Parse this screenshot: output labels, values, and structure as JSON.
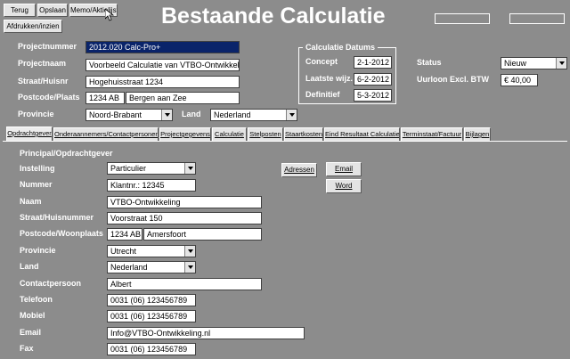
{
  "toolbar": {
    "back_label": "Terug",
    "save_label": "Opslaan",
    "memo_label": "Memo/Aktielijst",
    "print_label": "Afdrukken/inzien"
  },
  "title": "Bestaande Calculatie",
  "project": {
    "number_label": "Projectnummer",
    "number_value": "2012.020 Calc-Pro+",
    "name_label": "Projectnaam",
    "name_value": "Voorbeeld Calculatie van VTBO-Ontwikkeling",
    "street_label": "Straat/Huisnr",
    "street_value": "Hogehuisstraat 1234",
    "postcode_label": "Postcode/Plaats",
    "postcode_value": "1234 AB",
    "city_value": "Bergen aan Zee",
    "province_label": "Provincie",
    "province_value": "Noord-Brabant",
    "country_label": "Land",
    "country_value": "Nederland"
  },
  "dates": {
    "group_title": "Calculatie Datums",
    "concept_label": "Concept",
    "concept_value": "2-1-2012",
    "last_label": "Laatste wijz.",
    "last_value": "6-2-2012",
    "final_label": "Definitief",
    "final_value": "5-3-2012"
  },
  "status": {
    "label": "Status",
    "value": "Nieuw",
    "rate_label": "Uurloon Excl. BTW",
    "rate_value": "€ 40,00"
  },
  "tabs": [
    "Opdrachtgever",
    "Onderaannemers/Contactpersonen",
    "Projectgegevens",
    "Calculatie",
    "Stelposten",
    "Staartkosten",
    "Eind Resultaat Calculatie",
    "Terminstaat/Factuur",
    "Bijlagen"
  ],
  "client": {
    "section_title": "Principal/Opdrachtgever",
    "instelling_label": "Instelling",
    "instelling_value": "Particulier",
    "nummer_label": "Nummer",
    "nummer_value": "Klantnr.: 12345",
    "naam_label": "Naam",
    "naam_value": "VTBO-Ontwikkeling",
    "street_label": "Straat/Huisnummer",
    "street_value": "Voorstraat 150",
    "postcode_label": "Postcode/Woonplaats",
    "postcode_value": "1234 AB",
    "city_value": "Amersfoort",
    "province_label": "Provincie",
    "province_value": "Utrecht",
    "country_label": "Land",
    "country_value": "Nederland",
    "contact_label": "Contactpersoon",
    "contact_value": "Albert",
    "phone_label": "Telefoon",
    "phone_value": "0031 (06) 123456789",
    "mobile_label": "Mobiel",
    "mobile_value": "0031 (06) 123456789",
    "email_label": "Email",
    "email_value": "Info@VTBO-Ontwikkeling.nl",
    "fax_label": "Fax",
    "fax_value": "0031 (06) 123456789",
    "addresses_button": "Adressen",
    "email_button": "Email",
    "word_button": "Word"
  }
}
